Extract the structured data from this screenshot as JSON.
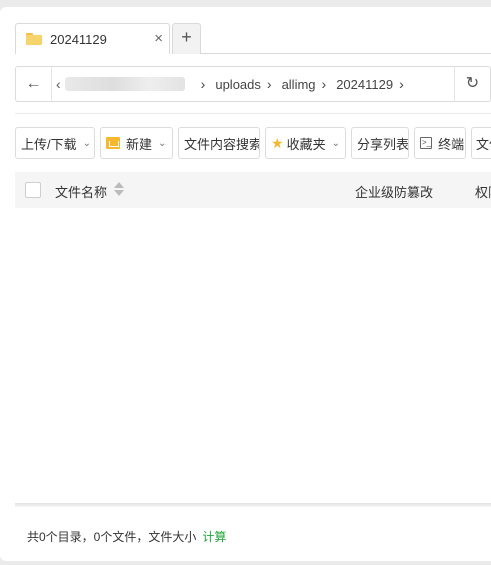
{
  "tab": {
    "title": "20241129",
    "close": "×",
    "new_tab": "+"
  },
  "address": {
    "back": "←",
    "prefix": "‹",
    "crumbs": [
      "uploads",
      "allimg",
      "20241129"
    ],
    "separator": "›",
    "refresh": "↻"
  },
  "toolbar": {
    "upload_download": "上传/下载",
    "new": "新建",
    "content_search": "文件内容搜索",
    "favorites": "收藏夹",
    "share_list": "分享列表",
    "terminal": "终端",
    "terminal_icon": ">_",
    "file_partial": "文件",
    "chevron": "⌄"
  },
  "table": {
    "col_name": "文件名称",
    "col_tamper": "企业级防篡改",
    "col_permission": "权限"
  },
  "footer": {
    "summary": "共0个目录，0个文件，文件大小",
    "calculate": "计算"
  },
  "colors": {
    "accent_green": "#20a53a",
    "folder_yellow": "#f5b82e"
  },
  "icons": [
    "folder-icon",
    "close-icon",
    "plus-icon",
    "back-arrow-icon",
    "chevron-right-icon",
    "refresh-icon",
    "chevron-down-icon",
    "new-folder-icon",
    "star-icon",
    "terminal-icon",
    "sort-icon"
  ]
}
